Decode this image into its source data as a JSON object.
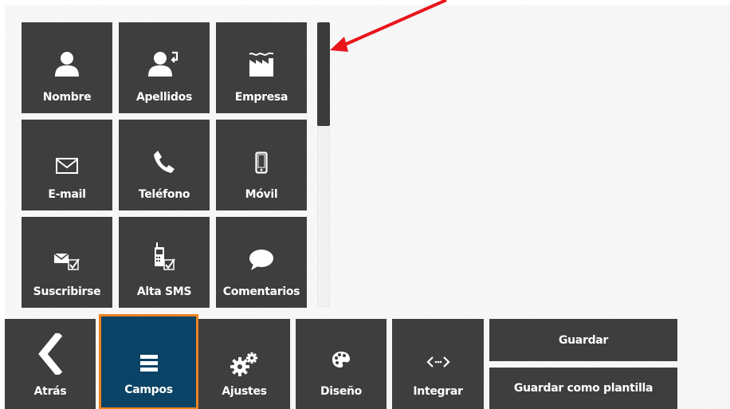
{
  "fields": [
    {
      "label": "Nombre",
      "icon": "person-icon"
    },
    {
      "label": "Apellidos",
      "icon": "person-arrow-icon"
    },
    {
      "label": "Empresa",
      "icon": "factory-icon"
    },
    {
      "label": "E-mail",
      "icon": "envelope-icon"
    },
    {
      "label": "Teléfono",
      "icon": "phone-icon"
    },
    {
      "label": "Móvil",
      "icon": "mobile-icon"
    },
    {
      "label": "Suscribirse",
      "icon": "envelope-check-icon"
    },
    {
      "label": "Alta SMS",
      "icon": "cellphone-check-icon"
    },
    {
      "label": "Comentarios",
      "icon": "speech-bubble-icon"
    }
  ],
  "toolbar": {
    "back_label": "Atrás",
    "fields_label": "Campos",
    "settings_label": "Ajustes",
    "design_label": "Diseño",
    "integrate_label": "Integrar",
    "save_label": "Guardar",
    "save_template_label": "Guardar como plantilla"
  },
  "colors": {
    "tile": "#3e3e3e",
    "active": "#0a4365",
    "active_outline": "#f0821e",
    "annotation_arrow": "#e8151b"
  }
}
